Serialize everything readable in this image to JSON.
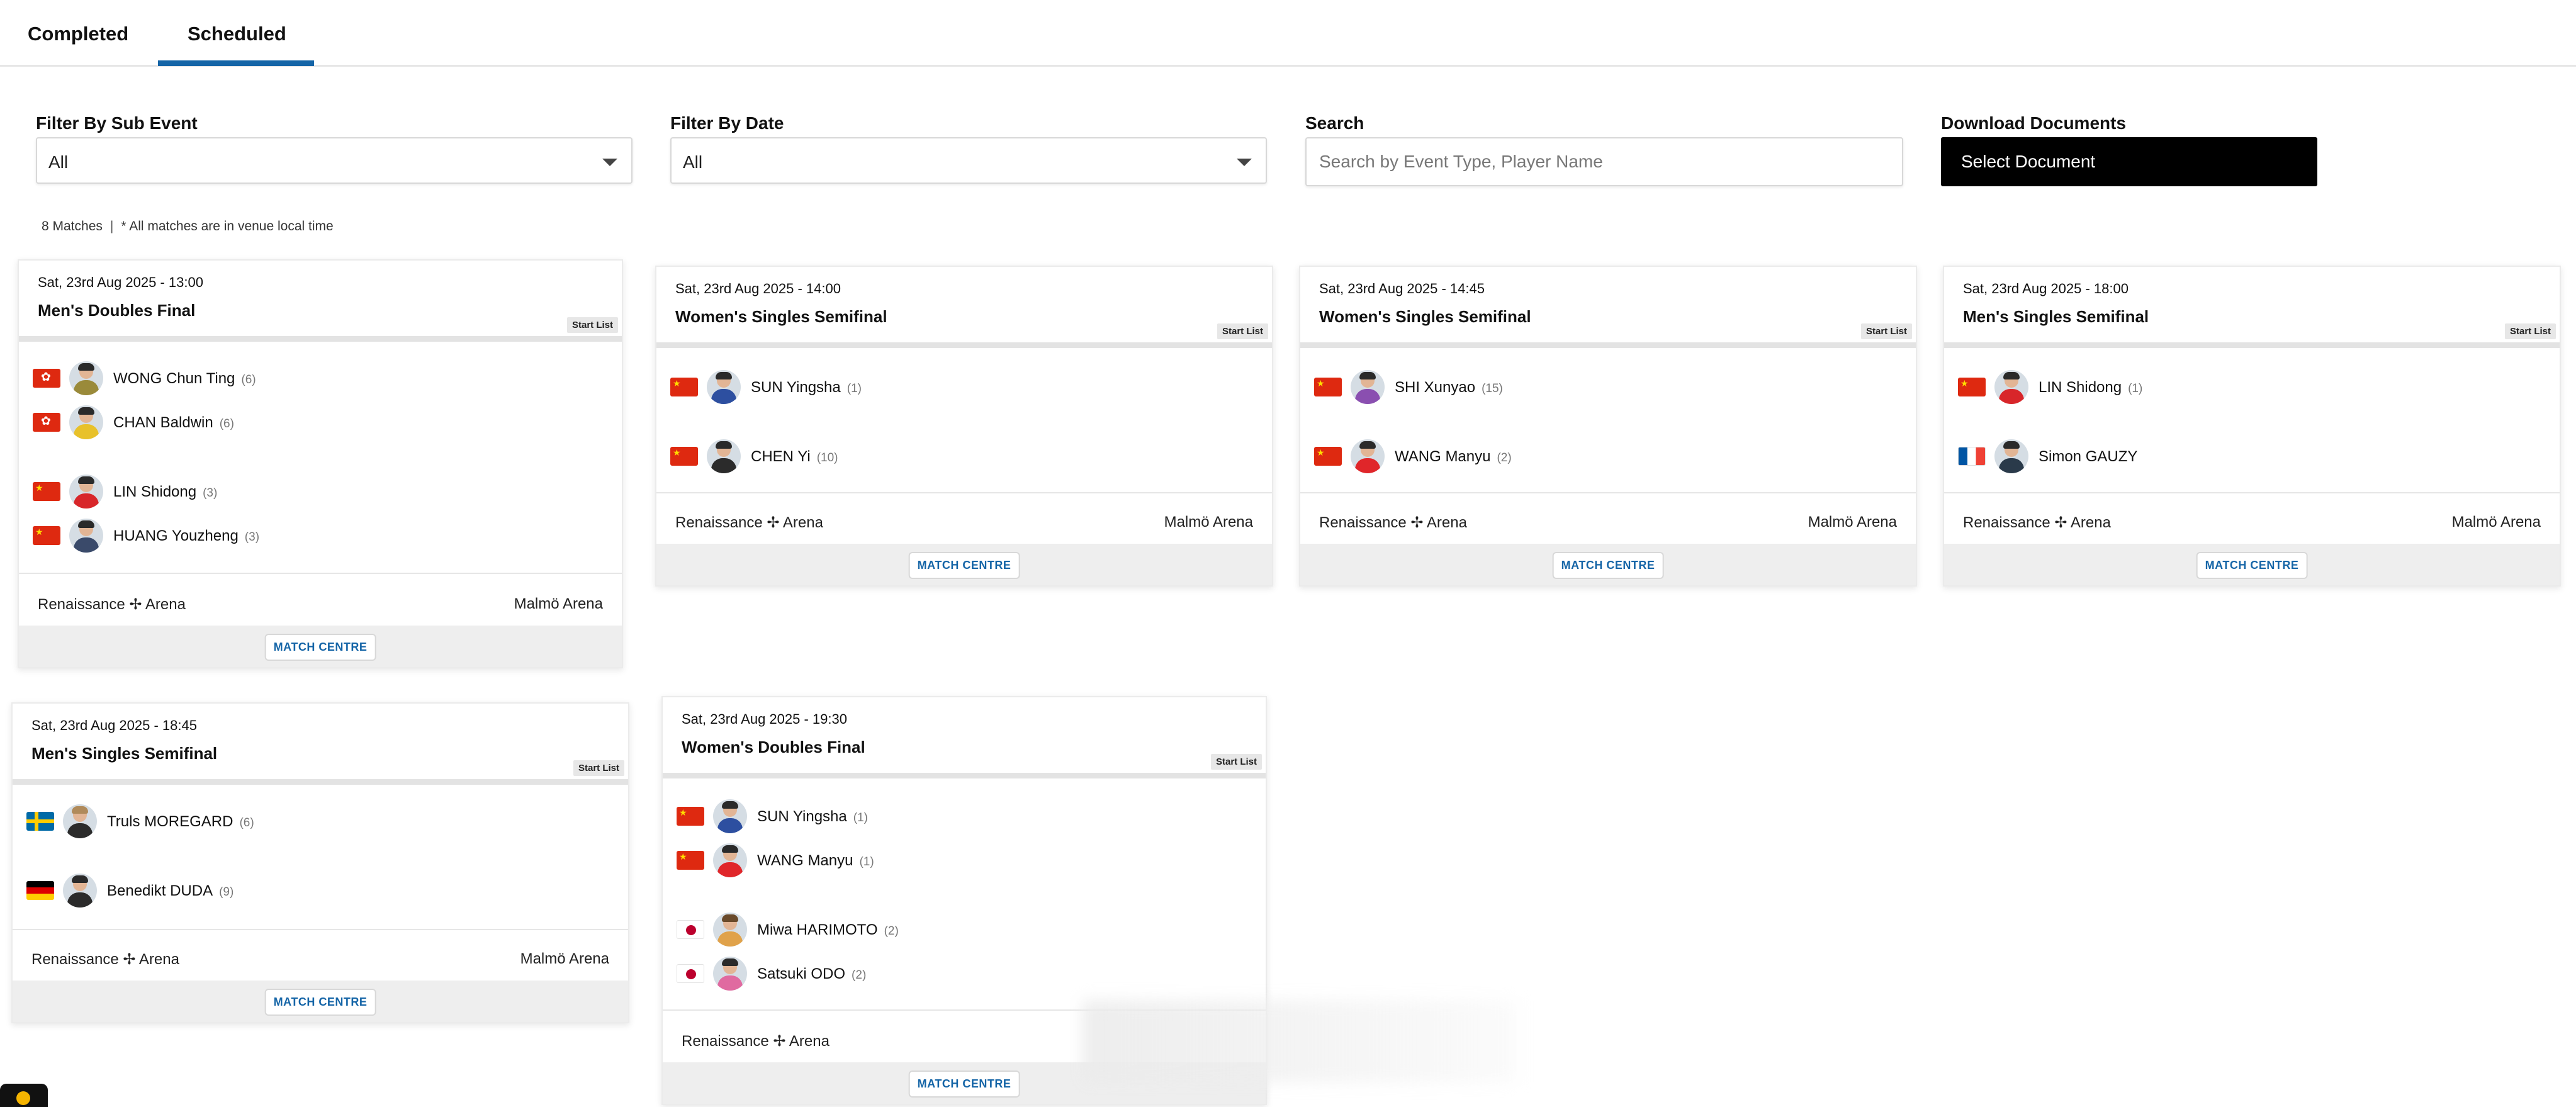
{
  "tabs": [
    {
      "label": "Completed",
      "active": false
    },
    {
      "label": "Scheduled",
      "active": true
    }
  ],
  "filters": {
    "sub_event": {
      "label": "Filter By Sub Event",
      "value": "All"
    },
    "date": {
      "label": "Filter By Date",
      "value": "All"
    },
    "search": {
      "label": "Search",
      "placeholder": "Search by Event Type, Player Name"
    },
    "documents": {
      "label": "Download Documents",
      "button_label": "Select Document"
    }
  },
  "summary": {
    "count": "8 Matches",
    "separator": "|",
    "note": "* All matches are in venue local time"
  },
  "labels": {
    "start_list": "Start List",
    "match_centre": "MATCH CENTRE"
  },
  "matches": [
    {
      "datetime": "Sat, 23rd Aug 2025 - 13:00",
      "event": "Men's Doubles Final",
      "players": [
        {
          "name": "WONG Chun Ting",
          "seed": "(6)",
          "flag": "hong-kong-flag"
        },
        {
          "name": "CHAN Baldwin",
          "seed": "(6)",
          "flag": "hong-kong-flag"
        },
        {
          "name": "LIN Shidong",
          "seed": "(3)",
          "flag": "china-flag"
        },
        {
          "name": "HUANG Youzheng",
          "seed": "(3)",
          "flag": "china-flag"
        }
      ],
      "venue": "Renaissance ✢ Arena",
      "location": "Malmö Arena"
    },
    {
      "datetime": "Sat, 23rd Aug 2025 - 14:00",
      "event": "Women's Singles Semifinal",
      "players": [
        {
          "name": "SUN Yingsha",
          "seed": "(1)",
          "flag": "china-flag"
        },
        {
          "name": "CHEN Yi",
          "seed": "(10)",
          "flag": "china-flag"
        }
      ],
      "venue": "Renaissance ✢ Arena",
      "location": "Malmö Arena"
    },
    {
      "datetime": "Sat, 23rd Aug 2025 - 14:45",
      "event": "Women's Singles Semifinal",
      "players": [
        {
          "name": "SHI Xunyao",
          "seed": "(15)",
          "flag": "china-flag"
        },
        {
          "name": "WANG Manyu",
          "seed": "(2)",
          "flag": "china-flag"
        }
      ],
      "venue": "Renaissance ✢ Arena",
      "location": "Malmö Arena"
    },
    {
      "datetime": "Sat, 23rd Aug 2025 - 18:00",
      "event": "Men's Singles Semifinal",
      "players": [
        {
          "name": "LIN Shidong",
          "seed": "(1)",
          "flag": "china-flag"
        },
        {
          "name": "Simon GAUZY",
          "seed": "",
          "flag": "france-flag"
        }
      ],
      "venue": "Renaissance ✢ Arena",
      "location": "Malmö Arena"
    },
    {
      "datetime": "Sat, 23rd Aug 2025 - 18:45",
      "event": "Men's Singles Semifinal",
      "players": [
        {
          "name": "Truls MOREGARD",
          "seed": "(6)",
          "flag": "sweden-flag"
        },
        {
          "name": "Benedikt DUDA",
          "seed": "(9)",
          "flag": "germany-flag"
        }
      ],
      "venue": "Renaissance ✢ Arena",
      "location": "Malmö Arena"
    },
    {
      "datetime": "Sat, 23rd Aug 2025 - 19:30",
      "event": "Women's Doubles Final",
      "players": [
        {
          "name": "SUN Yingsha",
          "seed": "(1)",
          "flag": "china-flag"
        },
        {
          "name": "WANG Manyu",
          "seed": "(1)",
          "flag": "china-flag"
        },
        {
          "name": "Miwa HARIMOTO",
          "seed": "(2)",
          "flag": "japan-flag"
        },
        {
          "name": "Satsuki ODO",
          "seed": "(2)",
          "flag": "japan-flag"
        }
      ],
      "venue": "Renaissance ✢ Arena",
      "location": ""
    }
  ],
  "colors": {
    "accent": "#1565a7",
    "button_dark": "#000000",
    "footer_bar": "#eeeeee"
  }
}
